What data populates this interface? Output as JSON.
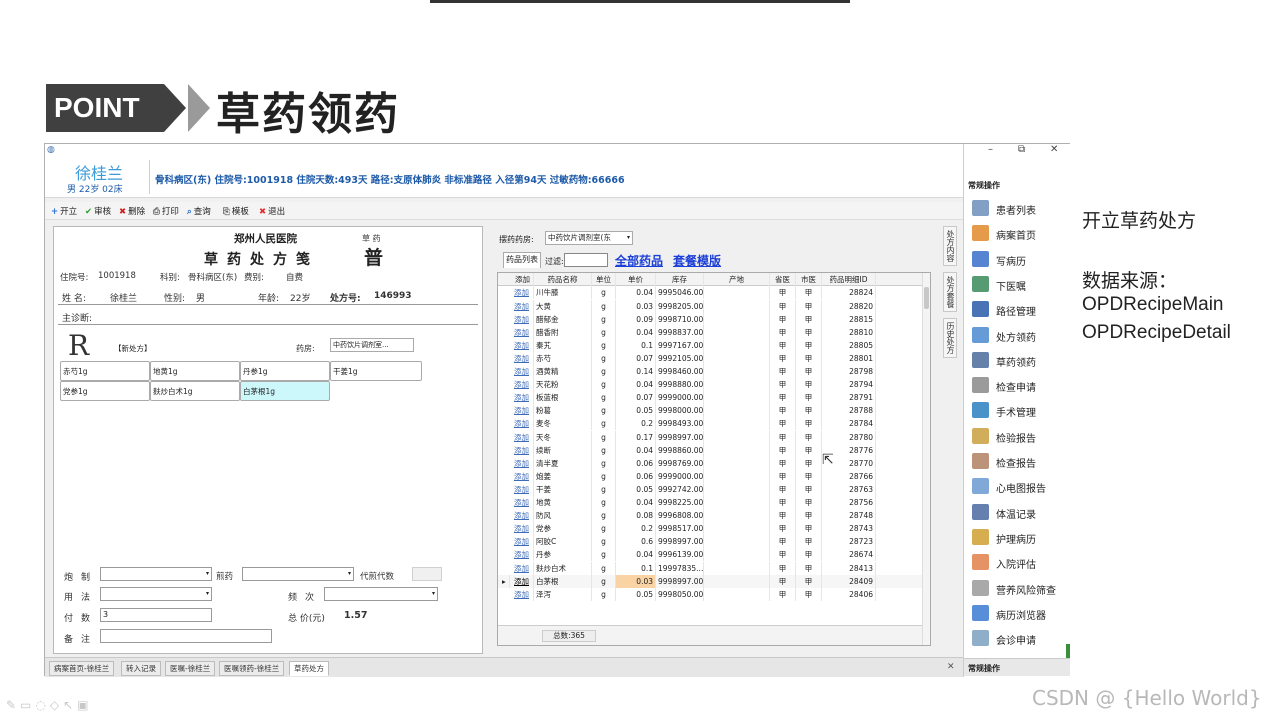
{
  "slide": {
    "point_label": "POINT",
    "title": "草药领药",
    "note_action": "开立草药处方",
    "note_source_label": "数据来源：",
    "note_table_main": "OPDRecipeMain",
    "note_table_detail": "OPDRecipeDetail",
    "brand": "CSDN @ {Hello World}",
    "footer_tools": "✎▭◌◇↖▣"
  },
  "app": {
    "icon": "◍",
    "patient": {
      "name": "徐桂兰",
      "sub": "男 22岁 02床",
      "info": "骨科病区(东) 住院号:1001918 住院天数:493天  路径:支原体肺炎 非标准路径 入径第94天 过敏药物:66666"
    },
    "toolbar": [
      {
        "icon": "+",
        "label": "开立",
        "color": "#2a6fd0"
      },
      {
        "icon": "✔",
        "label": "审核",
        "color": "#2a9a2a"
      },
      {
        "icon": "✖",
        "label": "删除",
        "color": "#d02020"
      },
      {
        "icon": "⎙",
        "label": "打印",
        "color": "#555555"
      },
      {
        "icon": "⌕",
        "label": "查询",
        "color": "#2a6fd0"
      },
      {
        "icon": "⎘",
        "label": "模板",
        "color": "#555555"
      },
      {
        "icon": "✖",
        "label": "退出",
        "color": "#e03030"
      }
    ],
    "rx": {
      "hospital": "郑州人民医院",
      "kind": "草 药",
      "title": "草药处方笺",
      "pu": "普",
      "inpatient_no_label": "住院号:",
      "inpatient_no": "1001918",
      "dept_label": "科别:",
      "dept": "骨科病区(东)",
      "fee_label": "费别:",
      "fee": "自费",
      "name_label": "姓 名:",
      "name": "徐桂兰",
      "sex_label": "性别:",
      "sex": "男",
      "age_label": "年龄:",
      "age": "22岁",
      "rx_no_label": "处方号:",
      "rx_no": "146993",
      "diagnosis_label": "主诊断:",
      "new_label": "【新处方】",
      "pharmacy_label": "药房:",
      "pharmacy_value": "中药饮片调剂室...",
      "herbs": [
        "赤芍1g",
        "地黄1g",
        "丹参1g",
        "干姜1g",
        "党参1g",
        "麸炒白术1g",
        "白茅根1g"
      ],
      "processing_label": "炮制",
      "decoct_label": "煎药",
      "decoct_gen_label": "代煎代数",
      "usage_label": "用法",
      "freq_label": "频次",
      "doses_label": "付数",
      "doses_value": "3",
      "total_label": "总 价(元)",
      "total_value": "1.57",
      "remark_label": "备注"
    },
    "drugs": {
      "pharmacy_label": "摆药药房:",
      "pharmacy_value": "中药饮片调剂室(东",
      "tab_list": "药品列表",
      "filter_label": "过滤:",
      "link_all": "全部药品",
      "link_template": "套餐模版",
      "columns": [
        "添加",
        "药品名称",
        "单位",
        "单价",
        "库存",
        "产地",
        "省医",
        "市医",
        "药品明细ID"
      ],
      "add_text": "添加",
      "rows": [
        [
          "川牛膝",
          "g",
          "0.04",
          "9995046.00",
          "",
          "甲",
          "甲",
          "28824"
        ],
        [
          "大黄",
          "g",
          "0.03",
          "9998205.00",
          "",
          "甲",
          "甲",
          "28820"
        ],
        [
          "醋郁金",
          "g",
          "0.09",
          "9998710.00",
          "",
          "甲",
          "甲",
          "28815"
        ],
        [
          "醋香附",
          "g",
          "0.04",
          "9998837.00",
          "",
          "甲",
          "甲",
          "28810"
        ],
        [
          "秦艽",
          "g",
          "0.1",
          "9997167.00",
          "",
          "甲",
          "甲",
          "28805"
        ],
        [
          "赤芍",
          "g",
          "0.07",
          "9992105.00",
          "",
          "甲",
          "甲",
          "28801"
        ],
        [
          "酒黄精",
          "g",
          "0.14",
          "9998460.00",
          "",
          "甲",
          "甲",
          "28798"
        ],
        [
          "天花粉",
          "g",
          "0.04",
          "9998880.00",
          "",
          "甲",
          "甲",
          "28794"
        ],
        [
          "板蓝根",
          "g",
          "0.07",
          "9999000.00",
          "",
          "甲",
          "甲",
          "28791"
        ],
        [
          "粉葛",
          "g",
          "0.05",
          "9998000.00",
          "",
          "甲",
          "甲",
          "28788"
        ],
        [
          "麦冬",
          "g",
          "0.2",
          "9998493.00",
          "",
          "甲",
          "甲",
          "28784"
        ],
        [
          "天冬",
          "g",
          "0.17",
          "9998997.00",
          "",
          "甲",
          "甲",
          "28780"
        ],
        [
          "续断",
          "g",
          "0.04",
          "9998860.00",
          "",
          "甲",
          "甲",
          "28776"
        ],
        [
          "清半夏",
          "g",
          "0.06",
          "9998769.00",
          "",
          "甲",
          "甲",
          "28770"
        ],
        [
          "炮姜",
          "g",
          "0.06",
          "9999000.00",
          "",
          "甲",
          "甲",
          "28766"
        ],
        [
          "干姜",
          "g",
          "0.05",
          "9992742.00",
          "",
          "甲",
          "甲",
          "28763"
        ],
        [
          "地黄",
          "g",
          "0.04",
          "9998225.00",
          "",
          "甲",
          "甲",
          "28756"
        ],
        [
          "防风",
          "g",
          "0.08",
          "9996808.00",
          "",
          "甲",
          "甲",
          "28748"
        ],
        [
          "党参",
          "g",
          "0.2",
          "9998517.00",
          "",
          "甲",
          "甲",
          "28743"
        ],
        [
          "阿胶C",
          "g",
          "0.6",
          "9998997.00",
          "",
          "甲",
          "甲",
          "28723"
        ],
        [
          "丹参",
          "g",
          "0.04",
          "9996139.00",
          "",
          "甲",
          "甲",
          "28674"
        ],
        [
          "麸炒白术",
          "g",
          "0.1",
          "19997835...",
          "",
          "甲",
          "甲",
          "28413"
        ],
        [
          "白茅根",
          "g",
          "0.03",
          "9998997.00",
          "",
          "甲",
          "甲",
          "28409"
        ],
        [
          "泽泻",
          "g",
          "0.05",
          "9998050.00",
          "",
          "甲",
          "甲",
          "28406"
        ]
      ],
      "selected_row_marker": "▸",
      "total": "总数:365"
    },
    "vtabs": [
      "处方内容",
      "处方套餐",
      "历史处方"
    ],
    "bottom_tabs": [
      "病案首页-徐桂兰",
      "转入记录",
      "医嘱-徐桂兰",
      "医嘱领药-徐桂兰",
      "草药处方"
    ],
    "sidebar": {
      "section": "常规操作",
      "section_bottom": "常规操作",
      "items": [
        {
          "label": "患者列表",
          "color": "#6b8fb8"
        },
        {
          "label": "病案首页",
          "color": "#e08a2a"
        },
        {
          "label": "写病历",
          "color": "#3a6fc8"
        },
        {
          "label": "下医嘱",
          "color": "#3a8a5a"
        },
        {
          "label": "路径管理",
          "color": "#2a5aa8"
        },
        {
          "label": "处方领药",
          "color": "#4a8ad0"
        },
        {
          "label": "草药领药",
          "color": "#4a6a9a"
        },
        {
          "label": "检查申请",
          "color": "#8a8a8a"
        },
        {
          "label": "手术管理",
          "color": "#2a80c0"
        },
        {
          "label": "检验报告",
          "color": "#c8a040"
        },
        {
          "label": "检查报告",
          "color": "#b08060"
        },
        {
          "label": "心电图报告",
          "color": "#6a9ad0"
        },
        {
          "label": "体温记录",
          "color": "#4a6aa0"
        },
        {
          "label": "护理病历",
          "color": "#d0a030"
        },
        {
          "label": "入院评估",
          "color": "#e0804a"
        },
        {
          "label": "营养风险筛查",
          "color": "#9a9a9a"
        },
        {
          "label": "病历浏览器",
          "color": "#3a7ad0"
        },
        {
          "label": "会诊申请",
          "color": "#7aa0c0"
        }
      ]
    },
    "window_controls": {
      "min": "–",
      "max": "⧉",
      "close": "✕"
    }
  }
}
